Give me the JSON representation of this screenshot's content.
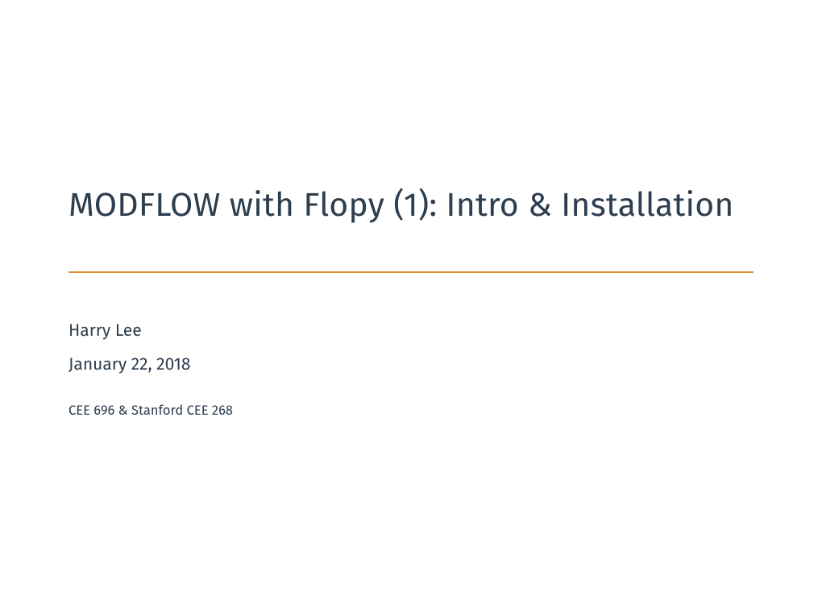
{
  "slide": {
    "title": "MODFLOW with Flopy (1): Intro & Installation",
    "author": "Harry Lee",
    "date": "January 22, 2018",
    "course": "CEE 696 & Stanford CEE 268"
  },
  "colors": {
    "text": "#2d3e4f",
    "accent": "#e18a34",
    "background": "#ffffff"
  }
}
